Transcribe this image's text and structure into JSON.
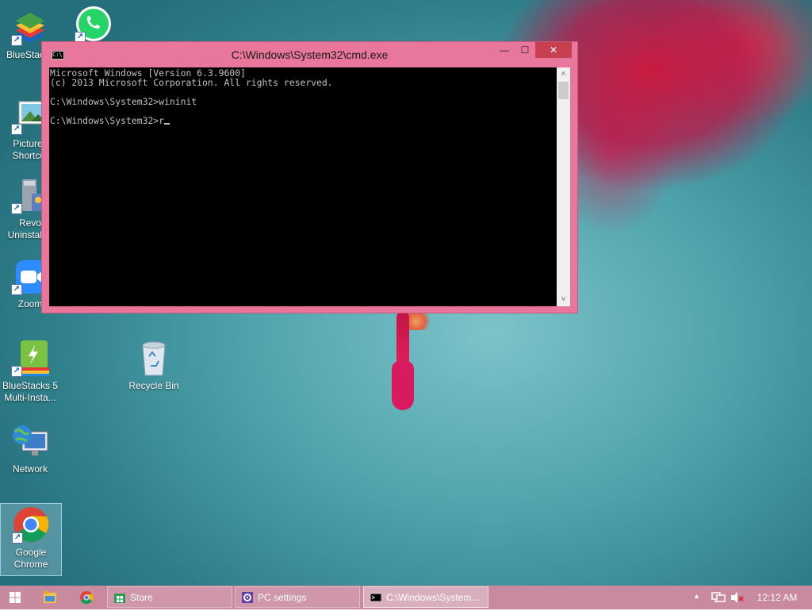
{
  "desktop": {
    "icons": [
      {
        "label": "BlueStacks",
        "icon": "bluestacks-icon"
      },
      {
        "label": "",
        "icon": "whatsapp-icon"
      },
      {
        "label": "Pictures Shortcut",
        "label_line1": "Pictures",
        "label_line2": "Shortcut",
        "icon": "pictures-icon"
      },
      {
        "label": "Revo Uninstaller",
        "label_line1": "Revo",
        "label_line2": "Uninstaller",
        "icon": "revo-uninstaller-icon"
      },
      {
        "label": "Zoom",
        "icon": "zoom-icon"
      },
      {
        "label": "BlueStacks 5 Multi-Insta...",
        "label_line1": "BlueStacks 5",
        "label_line2": "Multi-Insta...",
        "icon": "bluestacks5-multi-instance-icon"
      },
      {
        "label": "Recycle Bin",
        "icon": "recycle-bin-icon"
      },
      {
        "label": "Network",
        "icon": "network-icon"
      },
      {
        "label": "Google Chrome",
        "label_line1": "Google",
        "label_line2": "Chrome",
        "icon": "chrome-icon"
      }
    ]
  },
  "cmd": {
    "title": "C:\\Windows\\System32\\cmd.exe",
    "icon_text": "C:\\",
    "minimize": "—",
    "maximize": "☐",
    "close": "✕",
    "lines": [
      "Microsoft Windows [Version 6.3.9600]",
      "(c) 2013 Microsoft Corporation. All rights reserved.",
      "",
      "C:\\Windows\\System32>wininit",
      "",
      "C:\\Windows\\System32>r"
    ],
    "scroll_up": "˄",
    "scroll_down": "˅"
  },
  "taskbar": {
    "tasks": [
      {
        "label": "Store",
        "icon": "store-icon",
        "active": false
      },
      {
        "label": "PC settings",
        "icon": "gear-icon",
        "active": false
      },
      {
        "label": "C:\\Windows\\System...",
        "icon": "cmd-icon",
        "active": true
      }
    ],
    "tray_up": "▲",
    "clock": "12:12 AM"
  },
  "colors": {
    "window_frame": "#e8779b",
    "taskbar": "#c9899e",
    "close_button": "#c7404f",
    "console_bg": "#000000",
    "console_text": "#c0c0c0"
  }
}
